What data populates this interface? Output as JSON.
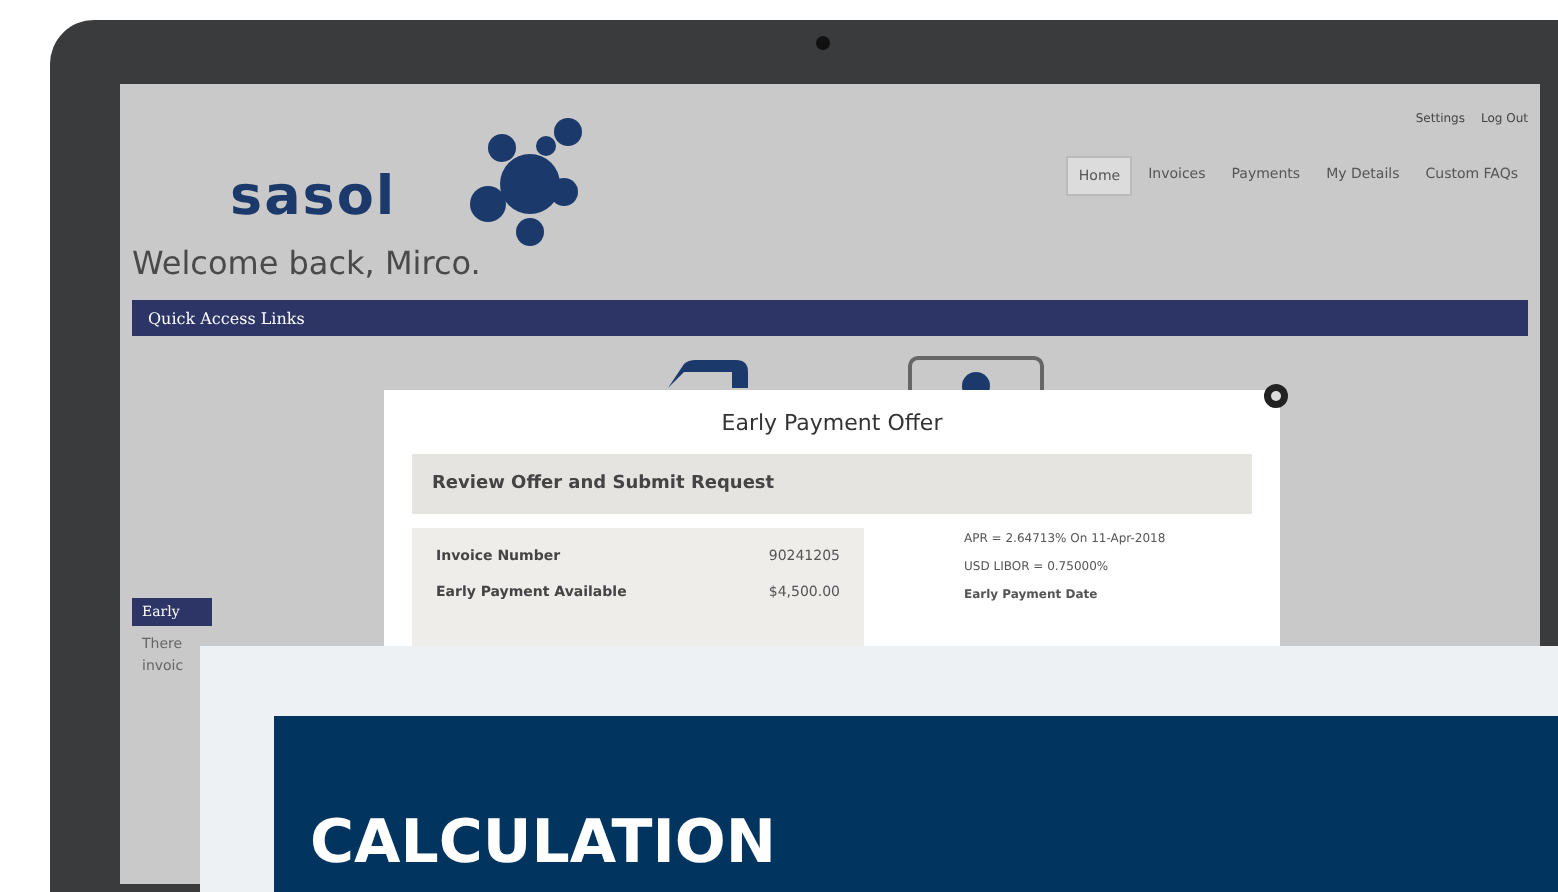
{
  "screen": {
    "top_links": [
      "Settings",
      "Log Out"
    ],
    "logo": {
      "wordmark": "sasol"
    },
    "nav": [
      {
        "label": "Home",
        "selected": true
      },
      {
        "label": "Invoices",
        "selected": false
      },
      {
        "label": "Payments",
        "selected": false
      },
      {
        "label": "My Details",
        "selected": false
      },
      {
        "label": "Custom FAQs",
        "selected": false
      }
    ],
    "welcome": "Welcome back, Mirco.",
    "quick_access": {
      "title": "Quick Access Links"
    },
    "side_panel": {
      "title": "Early",
      "lines": [
        "There",
        "invoic"
      ]
    },
    "modal": {
      "title": "Early Payment Offer",
      "section": "Review Offer and Submit Request",
      "rows": [
        {
          "label": "Invoice Number",
          "value": "90241205"
        },
        {
          "label": "Early Payment Available",
          "value": "$4,500.00"
        }
      ],
      "notes": [
        {
          "text": "APR = 2.64713% On 11-Apr-2018",
          "bold": false
        },
        {
          "text": "USD LIBOR = 0.75000%",
          "bold": false
        },
        {
          "text": "Early Payment Date",
          "bold": true
        }
      ]
    }
  },
  "banner": {
    "heading": "CALCULATION"
  }
}
